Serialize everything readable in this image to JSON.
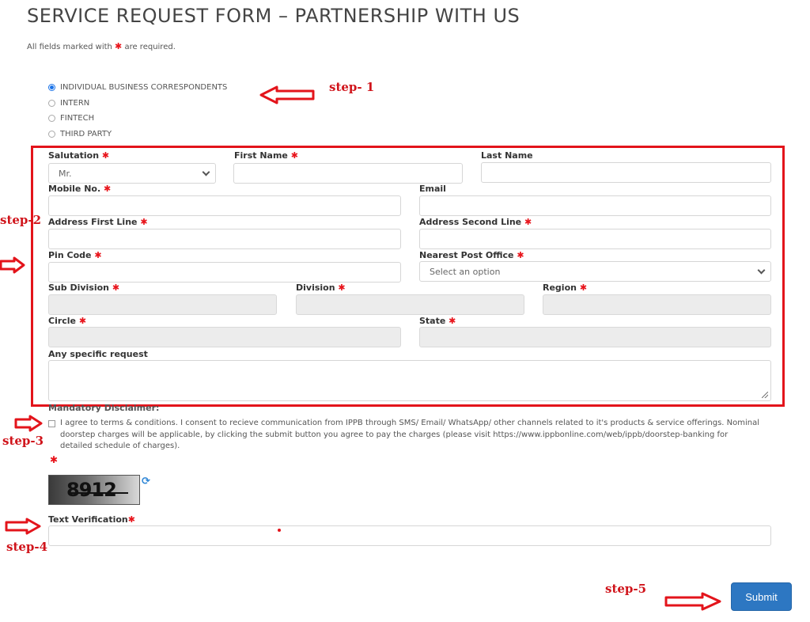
{
  "page": {
    "title": "SERVICE REQUEST FORM – PARTNERSHIP WITH US",
    "required_note_prefix": "All fields marked with",
    "required_note_suffix": "are required.",
    "required_marker": "✱"
  },
  "partner_types": {
    "selected": "INDIVIDUAL BUSINESS CORRESPONDENTS",
    "options": [
      {
        "label": "INDIVIDUAL BUSINESS CORRESPONDENTS",
        "checked": true
      },
      {
        "label": "INTERN",
        "checked": false
      },
      {
        "label": "FINTECH",
        "checked": false
      },
      {
        "label": "THIRD PARTY",
        "checked": false
      }
    ]
  },
  "form": {
    "salutation": {
      "label": "Salutation",
      "value": "Mr."
    },
    "first_name": {
      "label": "First Name",
      "value": ""
    },
    "last_name": {
      "label": "Last Name",
      "value": ""
    },
    "mobile": {
      "label": "Mobile No.",
      "value": ""
    },
    "email": {
      "label": "Email",
      "value": ""
    },
    "address1": {
      "label": "Address First Line",
      "value": ""
    },
    "address2": {
      "label": "Address Second Line",
      "value": ""
    },
    "pin_code": {
      "label": "Pin Code",
      "value": ""
    },
    "post_office": {
      "label": "Nearest Post Office",
      "placeholder": "Select an option"
    },
    "sub_division": {
      "label": "Sub Division",
      "value": ""
    },
    "division": {
      "label": "Division",
      "value": ""
    },
    "region": {
      "label": "Region",
      "value": ""
    },
    "circle": {
      "label": "Circle",
      "value": ""
    },
    "state": {
      "label": "State",
      "value": ""
    },
    "specific_request": {
      "label": "Any specific request",
      "value": ""
    }
  },
  "disclaimer": {
    "title": "Mandatory Disclaimer:",
    "text": "I agree to terms & conditions. I consent to recieve communication from IPPB through SMS/ Email/ WhatsApp/ other channels related to it's products & service offerings. Nominal doorstep charges will be applicable, by clicking the submit button you agree to pay the charges (please visit https://www.ippbonline.com/web/ippb/doorstep-banking for detailed schedule of charges).",
    "checked": false
  },
  "captcha": {
    "text": "8912",
    "refresh_icon": "⟳"
  },
  "verification": {
    "label": "Text Verification",
    "value": ""
  },
  "submit_label": "Submit",
  "annotations": {
    "step1": "step- 1",
    "step2": "step-2",
    "step3": "step-3",
    "step4": "step-4",
    "step5": "step-5",
    "accent_color": "#e3141b"
  }
}
